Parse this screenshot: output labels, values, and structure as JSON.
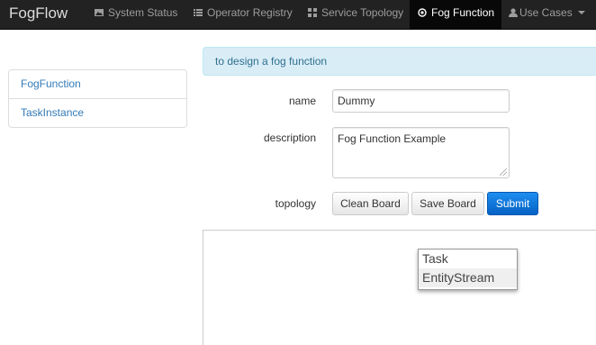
{
  "navbar": {
    "brand": "FogFlow",
    "items": [
      {
        "label": "System Status",
        "icon": "picture-icon"
      },
      {
        "label": "Operator Registry",
        "icon": "list-icon"
      },
      {
        "label": "Service Topology",
        "icon": "grid-icon"
      },
      {
        "label": "Fog Function",
        "icon": "target-icon",
        "active": true
      },
      {
        "label": "Use Cases",
        "icon": "user-icon",
        "dropdown": true
      }
    ]
  },
  "sidebar": {
    "items": [
      {
        "label": "FogFunction"
      },
      {
        "label": "TaskInstance"
      }
    ]
  },
  "main": {
    "info": "to design a fog function",
    "form": {
      "name_label": "name",
      "name_value": "Dummy",
      "description_label": "description",
      "description_value": "Fog Function Example",
      "topology_label": "topology"
    },
    "buttons": {
      "clean": "Clean Board",
      "save": "Save Board",
      "submit": "Submit"
    },
    "context_menu": {
      "items": [
        "Task",
        "EntityStream"
      ]
    }
  },
  "colors": {
    "navbar_bg": "#222222",
    "link": "#337ab7",
    "info_bg": "#d9edf7",
    "info_text": "#31708f",
    "primary": "#0662c4"
  }
}
